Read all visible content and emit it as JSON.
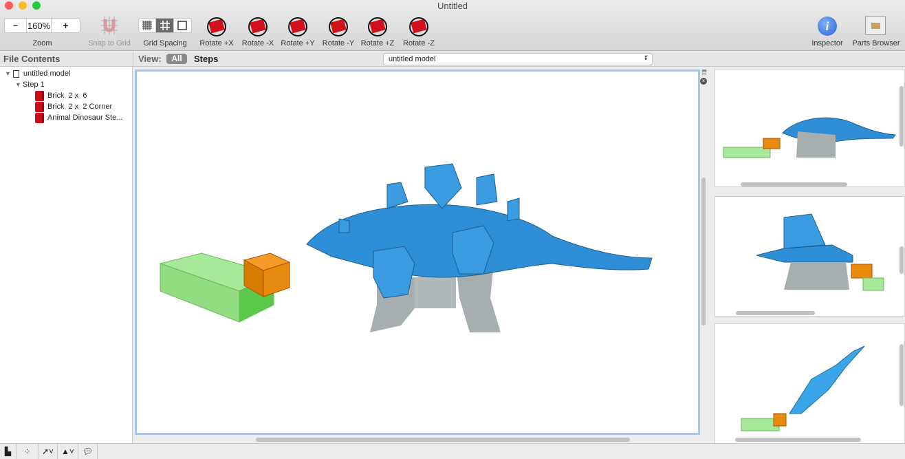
{
  "window": {
    "title": "Untitled"
  },
  "toolbar": {
    "zoom": {
      "minus": "−",
      "value": "160%",
      "plus": "+",
      "label": "Zoom"
    },
    "snap_label": "Snap to Grid",
    "grid_label": "Grid Spacing",
    "rotate": [
      "Rotate +X",
      "Rotate -X",
      "Rotate +Y",
      "Rotate -Y",
      "Rotate +Z",
      "Rotate -Z"
    ],
    "inspector_label": "Inspector",
    "parts_label": "Parts Browser"
  },
  "sidebar": {
    "header": "File Contents",
    "model": "untitled model",
    "step": "Step 1",
    "parts": [
      "Brick  2 x  6",
      "Brick  2 x  2 Corner",
      "Animal Dinosaur Ste..."
    ]
  },
  "viewbar": {
    "label": "View:",
    "all": "All",
    "steps": "Steps",
    "model_select": "untitled model"
  },
  "colors": {
    "accent": "#9fc8f4",
    "dino": "#2f8fd6",
    "brick_orange": "#e07b00",
    "brick_green": "#8fe07a"
  }
}
